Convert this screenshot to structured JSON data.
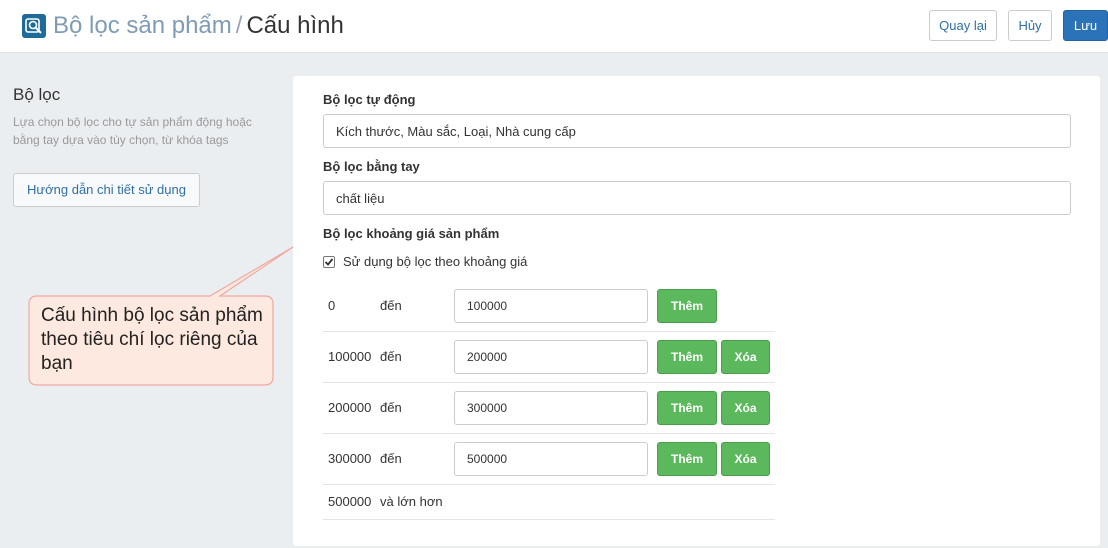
{
  "header": {
    "breadcrumb": "Bộ lọc sản phẩm",
    "separator": "/",
    "title": "Cấu hình",
    "back_label": "Quay lại",
    "cancel_label": "Hủy",
    "save_label": "Lưu",
    "icon": "filter-search-icon"
  },
  "sidebar": {
    "title": "Bộ lọc",
    "description": "Lựa chọn bộ lọc cho tự sản phẩm động hoặc bằng tay dựa vào tùy chọn, từ khóa tags",
    "help_label": "Hướng dẫn chi tiết sử dụng"
  },
  "form": {
    "auto_label": "Bộ lọc tự động",
    "auto_value": "Kích thước, Màu sắc, Loại, Nhà cung cấp",
    "manual_label": "Bộ lọc bằng tay",
    "manual_value": "chất liệu",
    "price_label": "Bộ lọc khoảng giá sản phẩm",
    "price_checkbox_label": "Sử dụng bộ lọc theo khoảng giá",
    "price_checkbox_checked": true,
    "price_rows": [
      {
        "from": "0",
        "to_word": "đến",
        "value": "100000",
        "add": "Thêm",
        "delete": ""
      },
      {
        "from": "100000",
        "to_word": "đến",
        "value": "200000",
        "add": "Thêm",
        "delete": "Xóa"
      },
      {
        "from": "200000",
        "to_word": "đến",
        "value": "300000",
        "add": "Thêm",
        "delete": "Xóa"
      },
      {
        "from": "300000",
        "to_word": "đến",
        "value": "500000",
        "add": "Thêm",
        "delete": "Xóa"
      }
    ],
    "last_row": {
      "from": "500000",
      "text": "và lớn hơn"
    }
  },
  "callout": {
    "text": "Cấu hình bộ lọc sản phẩm theo tiêu chí lọc riêng của bạn"
  },
  "colors": {
    "primary": "#2a73b8",
    "success": "#5cb85c",
    "callout_fill": "#fde9df",
    "callout_border": "#f0a8a0"
  }
}
